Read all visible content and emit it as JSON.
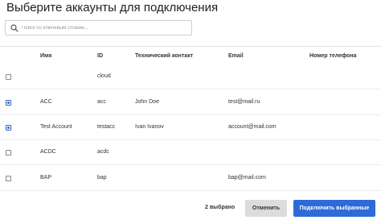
{
  "dialog": {
    "title": "Выберите аккаунты для подключения"
  },
  "search": {
    "placeholder": "Поиск по ключевым словам...",
    "value": "",
    "icon": "search-icon"
  },
  "table": {
    "columns": [
      "Имя",
      "ID",
      "Технический контакт",
      "Email",
      "Номер телефона"
    ],
    "rows": [
      {
        "selected": false,
        "name": "",
        "id": "cloud",
        "contact": "",
        "email": "",
        "phone": ""
      },
      {
        "selected": true,
        "name": "ACC",
        "id": "acc",
        "contact": "John Doe",
        "email": "test@mail.ru",
        "phone": ""
      },
      {
        "selected": true,
        "name": "Test Account",
        "id": "testacc",
        "contact": "Ivan Ivanov",
        "email": "account@mail.com",
        "phone": ""
      },
      {
        "selected": false,
        "name": "ACDC",
        "id": "acdc",
        "contact": "",
        "email": "",
        "phone": ""
      },
      {
        "selected": false,
        "name": "BAP",
        "id": "bap",
        "contact": "",
        "email": "bap@mail.com",
        "phone": ""
      }
    ]
  },
  "footer": {
    "selected_count": "2 выбрано",
    "cancel_label": "Отменить",
    "connect_label": "Подключить выбранные"
  },
  "colors": {
    "primary": "#2f6bd6",
    "secondary_button": "#dcdcdc"
  }
}
